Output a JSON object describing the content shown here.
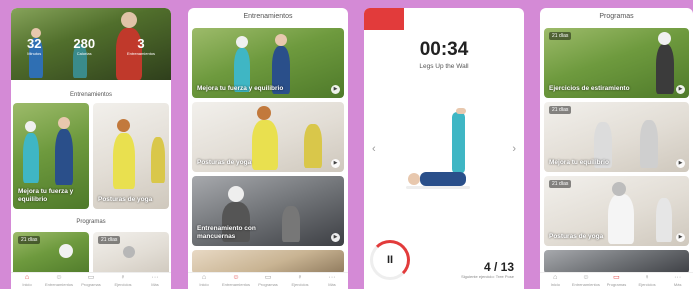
{
  "phone1": {
    "stats": [
      {
        "value": "32",
        "label": "Minutos"
      },
      {
        "value": "280",
        "label": "Calorías"
      },
      {
        "value": "3",
        "label": "Entrenamientos"
      }
    ],
    "section_workouts": "Entrenamientos",
    "cards": [
      {
        "label": "Mejora tu fuerza y equilibrio"
      },
      {
        "label": "Posturas de yoga"
      }
    ],
    "section_programs": "Programas",
    "program_badges": [
      "21 días",
      "21 días"
    ]
  },
  "phone2": {
    "title": "Entrenamientos",
    "cards": [
      {
        "label": "Mejora tu fuerza y equilibrio"
      },
      {
        "label": "Posturas de yoga"
      },
      {
        "label": "Entrenamiento con mancuernas"
      }
    ]
  },
  "phone3": {
    "timer": "00:34",
    "exercise": "Legs Up the Wall",
    "pause_symbol": "II",
    "counter": "4 / 13",
    "next_label": "Siguiente ejercicio: Tree Pose",
    "prev_arrow": "‹",
    "next_arrow": "›"
  },
  "phone4": {
    "title": "Programas",
    "cards": [
      {
        "badge": "21 días",
        "label": "Ejercicios de estiramiento"
      },
      {
        "badge": "21 días",
        "label": "Mejora tu equilibrio"
      },
      {
        "badge": "21 días",
        "label": "Posturas de yoga"
      }
    ]
  },
  "tabbar": {
    "tabs": [
      {
        "icon": "home-icon",
        "glyph": "⌂",
        "label": "Inicio"
      },
      {
        "icon": "user-icon",
        "glyph": "☺",
        "label": "Entrenamientos"
      },
      {
        "icon": "calendar-icon",
        "glyph": "▭",
        "label": "Programas"
      },
      {
        "icon": "figure-icon",
        "glyph": "♀",
        "label": "Ejercicios"
      },
      {
        "icon": "more-icon",
        "glyph": "···",
        "label": "Más"
      }
    ]
  },
  "colors": {
    "accent": "#e23b3b",
    "frame": "#d48ad6"
  }
}
